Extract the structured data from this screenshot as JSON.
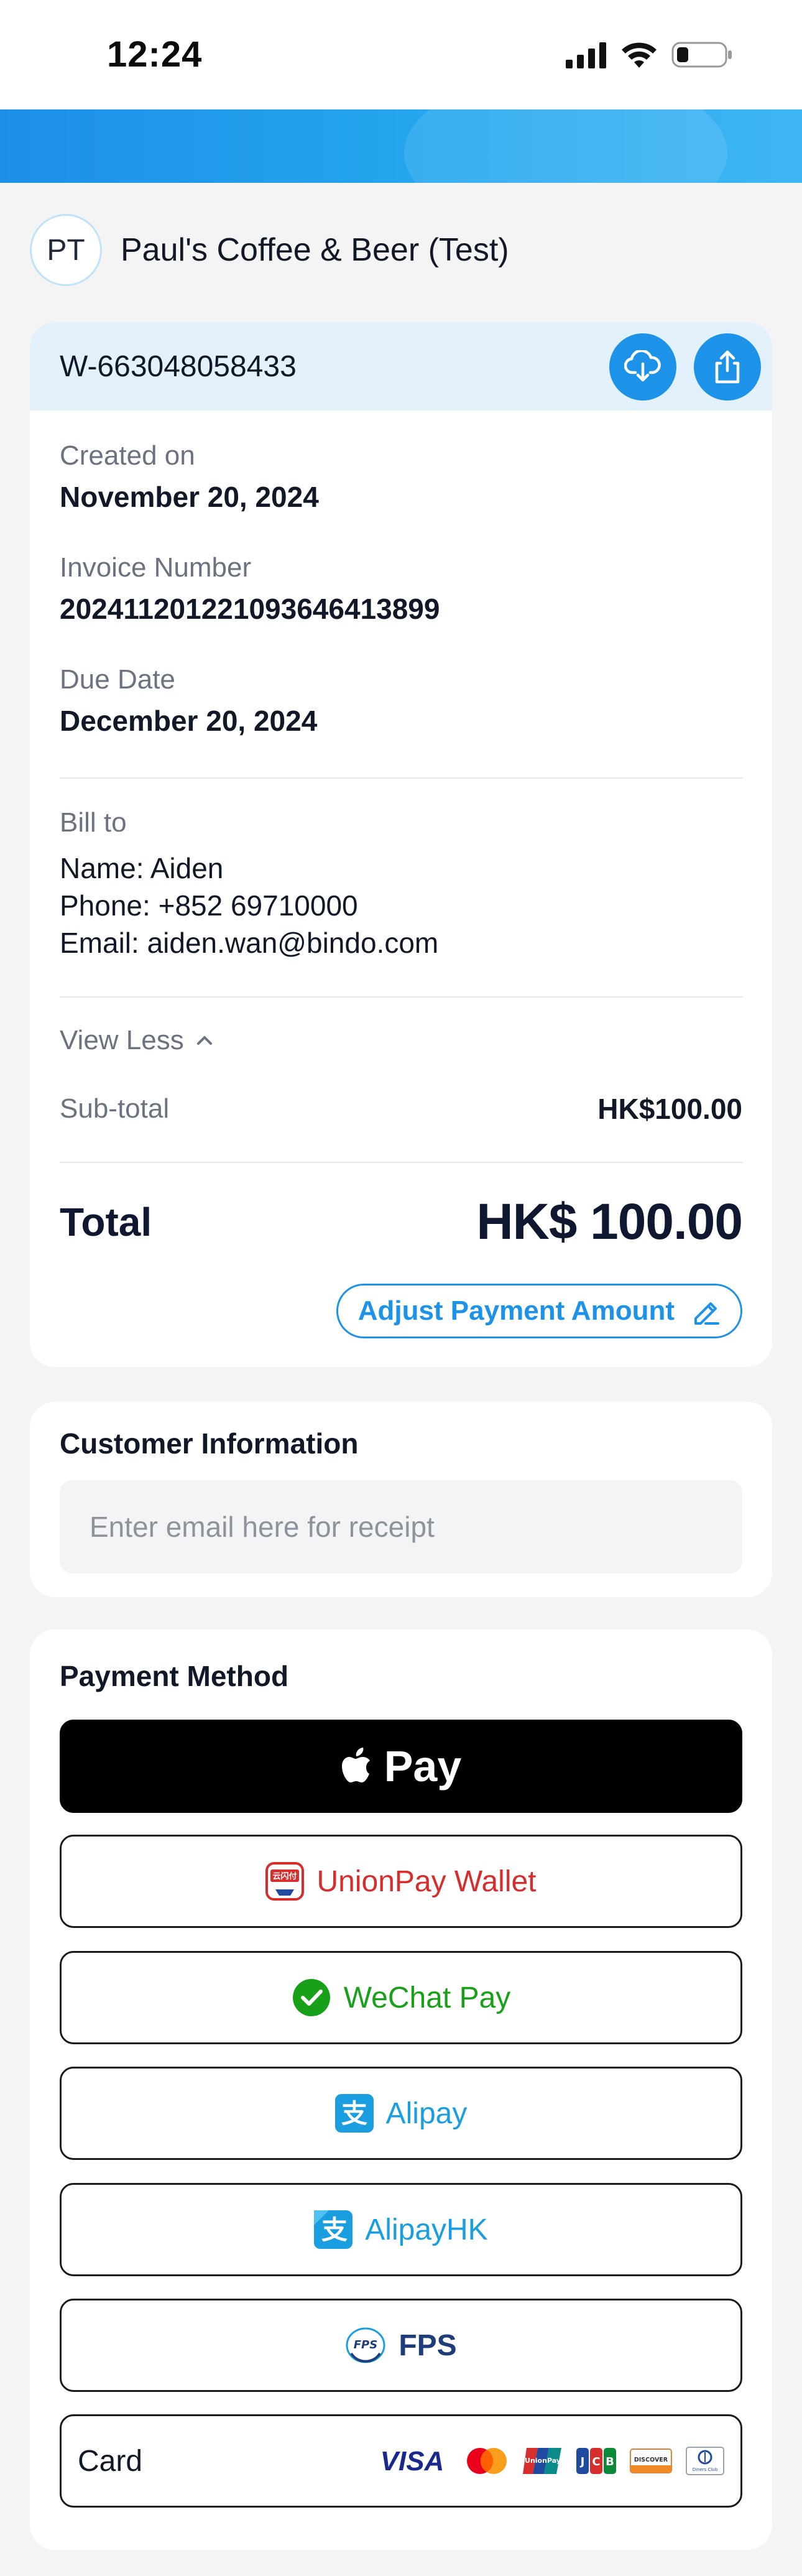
{
  "status_bar": {
    "time": "12:24"
  },
  "merchant": {
    "initials": "PT",
    "name": "Paul's Coffee & Beer (Test)"
  },
  "invoice": {
    "id": "W-663048058433",
    "created_label": "Created on",
    "created_value": "November 20, 2024",
    "number_label": "Invoice Number",
    "number_value": "20241120122109364641389​9",
    "due_label": "Due Date",
    "due_value": "December 20, 2024",
    "bill_to_label": "Bill to",
    "bill_to_lines": [
      "Name: Aiden",
      "Phone: +852 69710000",
      "Email: aiden.wan@bindo.com"
    ],
    "view_less_label": "View Less",
    "subtotal_label": "Sub-total",
    "subtotal_value": "HK$100.00",
    "total_label": "Total",
    "total_value": "HK$ 100.00",
    "adjust_label": "Adjust Payment Amount"
  },
  "customer": {
    "title": "Customer Information",
    "email_placeholder": "Enter email here for receipt",
    "email_value": ""
  },
  "payment": {
    "title": "Payment Method",
    "apple_pay_label": "Pay",
    "methods": [
      {
        "label": "UnionPay Wallet",
        "icon": "unionpay-wallet-icon"
      },
      {
        "label": "WeChat Pay",
        "icon": "wechat-icon"
      },
      {
        "label": "Alipay",
        "icon": "alipay-icon"
      },
      {
        "label": "AlipayHK",
        "icon": "alipayhk-icon"
      },
      {
        "label": "FPS",
        "icon": "fps-icon"
      }
    ],
    "card_label": "Card",
    "card_brands": [
      "VISA",
      "Mastercard",
      "UnionPay",
      "JCB",
      "DISCOVER",
      "Diners Club"
    ]
  },
  "colors": {
    "accent": "#1c92e8",
    "header_tint": "#e3f1fc",
    "unionpay_red": "#d62d2d",
    "wechat_green": "#19a019",
    "alipay_blue": "#1a9ee0"
  }
}
